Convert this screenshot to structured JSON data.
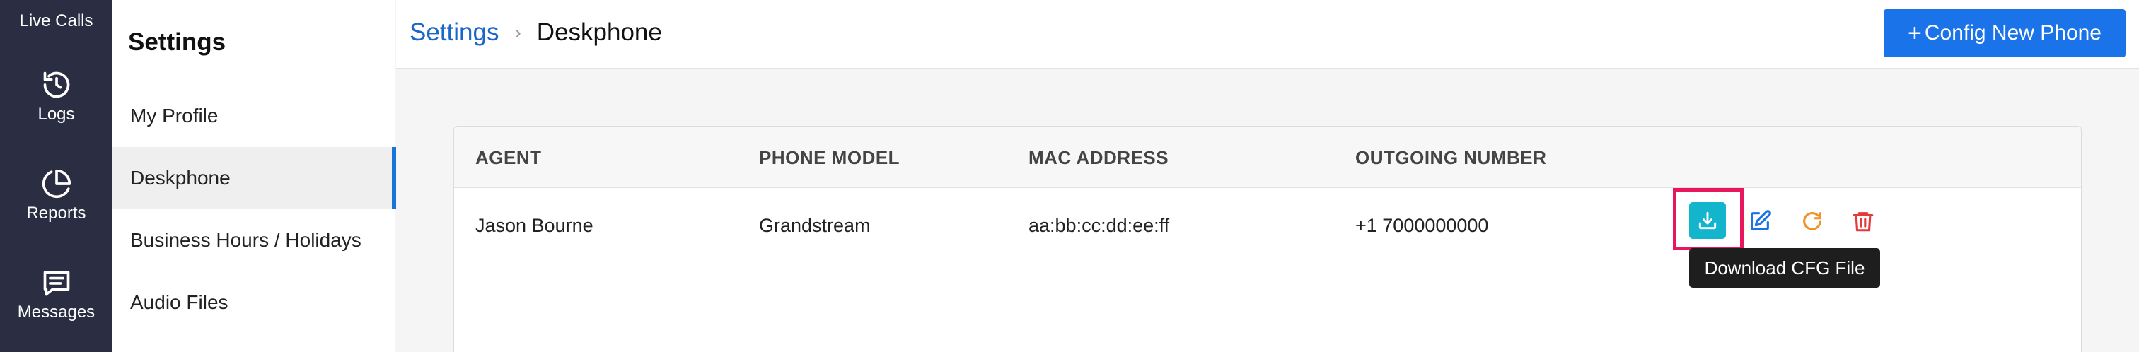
{
  "rail": {
    "live_calls": "Live Calls",
    "items": [
      {
        "label": "Logs",
        "icon": "history-icon"
      },
      {
        "label": "Reports",
        "icon": "pie-chart-icon"
      },
      {
        "label": "Messages",
        "icon": "message-icon"
      }
    ]
  },
  "sidebar": {
    "title": "Settings",
    "items": [
      {
        "label": "My Profile"
      },
      {
        "label": "Deskphone"
      },
      {
        "label": "Business Hours / Holidays"
      },
      {
        "label": "Audio Files"
      }
    ],
    "active_index": 1
  },
  "header": {
    "breadcrumb_root": "Settings",
    "breadcrumb_current": "Deskphone",
    "new_button_label": "Config New Phone"
  },
  "table": {
    "columns": [
      "AGENT",
      "PHONE MODEL",
      "MAC ADDRESS",
      "OUTGOING NUMBER"
    ],
    "rows": [
      {
        "agent": "Jason Bourne",
        "phone_model": "Grandstream",
        "mac": "aa:bb:cc:dd:ee:ff",
        "number": "+1 7000000000"
      }
    ]
  },
  "tooltip": "Download CFG File",
  "colors": {
    "rail_bg": "#2b2d42",
    "accent": "#1a73e8",
    "download_bg": "#12b5cb",
    "edit": "#1a73e8",
    "refresh": "#f0932b",
    "delete": "#e5393b",
    "highlight": "#e8175d"
  }
}
